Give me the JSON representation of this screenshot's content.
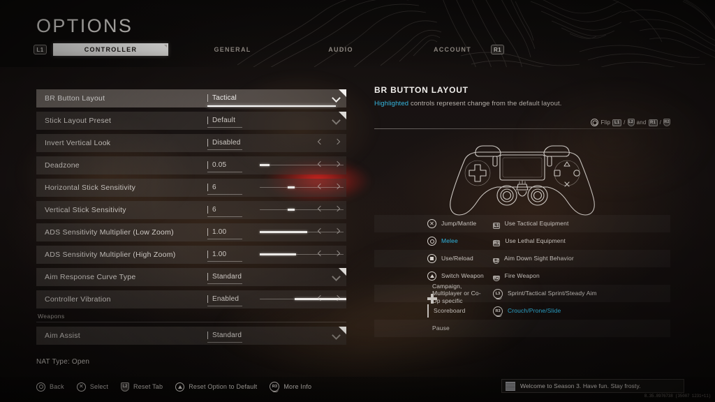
{
  "header": {
    "title": "OPTIONS",
    "left_bumper": "L1",
    "right_bumper": "R1",
    "tabs": [
      {
        "label": "CONTROLLER",
        "active": true
      },
      {
        "label": "GENERAL",
        "active": false
      },
      {
        "label": "AUDIO",
        "active": false
      },
      {
        "label": "ACCOUNT",
        "active": false
      }
    ]
  },
  "settings": {
    "rows": [
      {
        "label": "BR Button Layout",
        "value": "Tactical",
        "control": "dropdown",
        "selected": true
      },
      {
        "label": "Stick Layout Preset",
        "value": "Default",
        "control": "dropdown",
        "selected": false
      },
      {
        "label": "Invert Vertical Look",
        "value": "Disabled",
        "control": "arrows",
        "selected": false,
        "bar": 0
      },
      {
        "label": "Deadzone",
        "value": "0.05",
        "control": "slider",
        "selected": false,
        "fill_start": 0,
        "fill_width": 14
      },
      {
        "label": "Horizontal Stick Sensitivity",
        "value": "6",
        "control": "slider",
        "selected": false,
        "fill_start": 40,
        "fill_width": 10
      },
      {
        "label": "Vertical Stick Sensitivity",
        "value": "6",
        "control": "slider",
        "selected": false,
        "fill_start": 40,
        "fill_width": 10
      },
      {
        "label": "ADS Sensitivity Multiplier (Low Zoom)",
        "value": "1.00",
        "control": "slider",
        "selected": false,
        "fill_start": 0,
        "fill_width": 68
      },
      {
        "label": "ADS Sensitivity Multiplier (High Zoom)",
        "value": "1.00",
        "control": "slider",
        "selected": false,
        "fill_start": 0,
        "fill_width": 52
      },
      {
        "label": "Aim Response Curve Type",
        "value": "Standard",
        "control": "dropdown",
        "selected": false
      },
      {
        "label": "Controller Vibration",
        "value": "Enabled",
        "control": "slider",
        "selected": false,
        "fill_start": 50,
        "fill_width": 78
      }
    ],
    "section": {
      "label": "Weapons"
    },
    "section_rows": [
      {
        "label": "Aim Assist",
        "value": "Standard",
        "control": "dropdown",
        "selected": false
      }
    ]
  },
  "detail": {
    "title": "BR BUTTON LAYOUT",
    "subtitle_highlight": "Highlighted",
    "subtitle_rest": " controls represent change from the default layout.",
    "flip_hint": {
      "button": "circle-button",
      "label": "Flip",
      "pad1": "L1",
      "sep1": "/",
      "trig1": "L2",
      "and": "and",
      "pad2": "R1",
      "sep2": "/",
      "trig2": "R2"
    },
    "controller_art": "dualshock-4-outline"
  },
  "mappings": {
    "rows": [
      {
        "left_icon": "ps-cross",
        "left_label": "Jump/Mantle",
        "left_cyan": false,
        "right_icon": "L1",
        "right_icon_type": "bumper",
        "right_label": "Use Tactical Equipment",
        "right_cyan": false
      },
      {
        "left_icon": "ps-circle",
        "left_label": "Melee",
        "left_cyan": true,
        "right_icon": "R1",
        "right_icon_type": "bumper",
        "right_label": "Use Lethal Equipment",
        "right_cyan": false
      },
      {
        "left_icon": "ps-square",
        "left_label": "Use/Reload",
        "left_cyan": false,
        "right_icon": "L2",
        "right_icon_type": "trigger",
        "right_label": "Aim Down Sight Behavior",
        "right_cyan": false
      },
      {
        "left_icon": "ps-triangle",
        "left_label": "Switch Weapon",
        "left_cyan": false,
        "right_icon": "R2",
        "right_icon_type": "trigger",
        "right_label": "Fire Weapon",
        "right_cyan": false
      },
      {
        "left_icon": "dpad",
        "left_label": "Campaign, Multiplayer or Co-Op specific",
        "left_cyan": false,
        "right_icon": "L3",
        "right_icon_type": "stick",
        "right_label": "Sprint/Tactical Sprint/Steady Aim",
        "right_cyan": false
      },
      {
        "left_icon": "touchpad",
        "left_label": "Scoreboard",
        "left_cyan": false,
        "right_icon": "R3",
        "right_icon_type": "stick",
        "right_label": "Crouch/Prone/Slide",
        "right_cyan": true
      },
      {
        "left_icon": "options-button",
        "left_label": "Pause",
        "left_cyan": false,
        "right_icon": "",
        "right_icon_type": "none",
        "right_label": "",
        "right_cyan": false
      }
    ]
  },
  "footer": {
    "nat_type": "NAT Type: Open",
    "prompts": [
      {
        "icon": "ps-circle",
        "icon_type": "face",
        "label": "Back"
      },
      {
        "icon": "ps-cross",
        "icon_type": "face",
        "label": "Select"
      },
      {
        "icon": "L2",
        "icon_type": "trigger",
        "label": "Reset Tab"
      },
      {
        "icon": "ps-triangle",
        "icon_type": "face",
        "label": "Reset Option to Default"
      },
      {
        "icon": "R3",
        "icon_type": "stick",
        "label": "More Info"
      }
    ],
    "toast": {
      "text": "Welcome to Season 3. Have fun. Stay frosty."
    },
    "build": "8.35.8976738 (35007 1231+11)"
  },
  "colors": {
    "accent_cyan": "#2fb5df",
    "selected_white": "#f2f0ee",
    "text_primary": "#d7d2cd",
    "alert_red": "#ff2823"
  }
}
